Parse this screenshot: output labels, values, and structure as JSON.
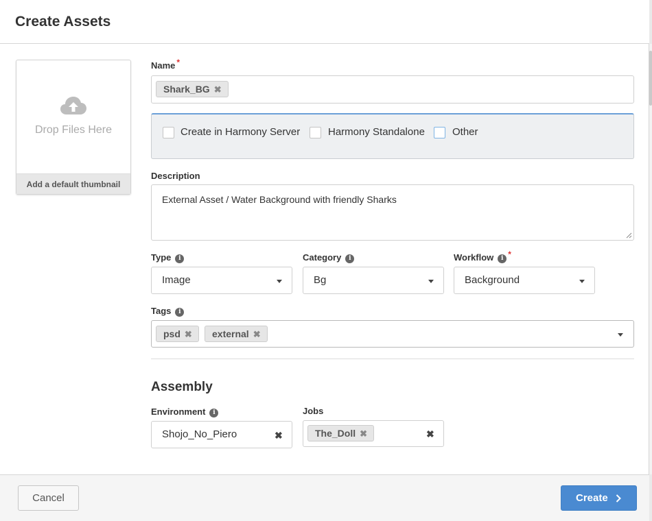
{
  "dialog": {
    "title": "Create Assets"
  },
  "thumbnail": {
    "drop_text": "Drop Files Here",
    "footer_label": "Add a default thumbnail"
  },
  "name_field": {
    "label": "Name",
    "required_mark": "*",
    "tags": [
      {
        "label": "Shark_BG"
      }
    ]
  },
  "harmony": {
    "options": [
      {
        "label": "Create in Harmony Server",
        "checked": false
      },
      {
        "label": "Harmony Standalone",
        "checked": false
      },
      {
        "label": "Other",
        "checked": false
      }
    ]
  },
  "description": {
    "label": "Description",
    "value": "External Asset / Water Background with friendly Sharks"
  },
  "type": {
    "label": "Type",
    "info_icon": "i",
    "value": "Image"
  },
  "category": {
    "label": "Category",
    "info_icon": "i",
    "value": "Bg"
  },
  "workflow": {
    "label": "Workflow",
    "info_icon": "i",
    "required_mark": "*",
    "value": "Background"
  },
  "tags": {
    "label": "Tags",
    "info_icon": "i",
    "items": [
      {
        "label": "psd"
      },
      {
        "label": "external"
      }
    ]
  },
  "assembly": {
    "section_title": "Assembly",
    "environment": {
      "label": "Environment",
      "info_icon": "i",
      "value": "Shojo_No_Piero"
    },
    "jobs": {
      "label": "Jobs",
      "tags": [
        {
          "label": "The_Doll"
        }
      ]
    }
  },
  "footer": {
    "cancel_label": "Cancel",
    "create_label": "Create"
  },
  "colors": {
    "primary_button": "#4a8ad1",
    "focus_border": "#6a9fd8",
    "required": "#dd3333"
  },
  "icons": {
    "upload": "cloud-upload-icon",
    "remove": "remove-x-icon",
    "info": "info-icon",
    "dropdown": "chevron-down-icon",
    "next": "chevron-right-icon"
  }
}
